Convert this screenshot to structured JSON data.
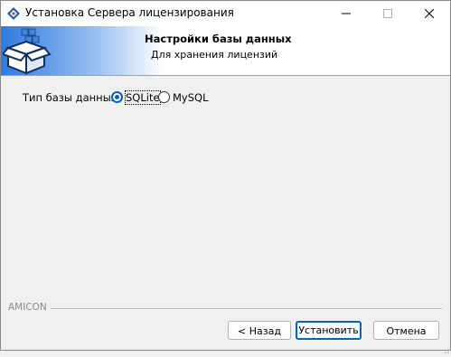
{
  "window": {
    "title": "Установка Сервера лицензирования",
    "controls": {
      "minimize": "minimize-icon",
      "maximize": "maximize-icon",
      "close": "close-icon"
    }
  },
  "header": {
    "title": "Настройки базы данных",
    "subtitle": "Для хранения лицензий"
  },
  "form": {
    "db_type_label": "Тип базы данных:",
    "options": [
      {
        "label": "SQLite",
        "selected": true
      },
      {
        "label": "MySQL",
        "selected": false
      }
    ]
  },
  "footer": {
    "brand": "AMICON",
    "back_label": "< Назад",
    "install_label": "Установить",
    "cancel_label": "Отмена"
  },
  "colors": {
    "accent": "#0067c0",
    "header_gradient_start": "#2f7be0"
  }
}
